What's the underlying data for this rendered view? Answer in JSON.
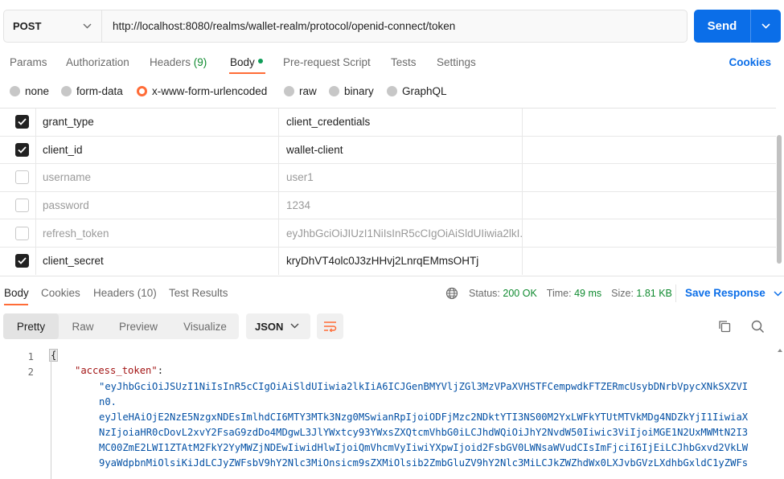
{
  "request": {
    "method": "POST",
    "url": "http://localhost:8080/realms/wallet-realm/protocol/openid-connect/token",
    "send_label": "Send"
  },
  "request_tabs": {
    "params": "Params",
    "authorization": "Authorization",
    "headers": "Headers",
    "headers_count": "(9)",
    "body": "Body",
    "pre_request": "Pre-request Script",
    "tests": "Tests",
    "settings": "Settings",
    "cookies": "Cookies"
  },
  "body_types": {
    "none": "none",
    "form_data": "form-data",
    "urlencoded": "x-www-form-urlencoded",
    "raw": "raw",
    "binary": "binary",
    "graphql": "GraphQL",
    "selected": "x-www-form-urlencoded"
  },
  "params": [
    {
      "checked": true,
      "key": "grant_type",
      "value": "client_credentials"
    },
    {
      "checked": true,
      "key": "client_id",
      "value": "wallet-client"
    },
    {
      "checked": false,
      "key": "username",
      "value": "user1"
    },
    {
      "checked": false,
      "key": "password",
      "value": "1234"
    },
    {
      "checked": false,
      "key": "refresh_token",
      "value": "eyJhbGciOiJIUzI1NiIsInR5cCIgOiAiSldUIiwia2lkI..."
    },
    {
      "checked": true,
      "key": "client_secret",
      "value": "kryDhVT4olc0J3zHHvj2LnrqEMmsOHTj"
    }
  ],
  "response_tabs": {
    "body": "Body",
    "cookies": "Cookies",
    "headers": "Headers (10)",
    "test_results": "Test Results"
  },
  "response_status": {
    "status_label": "Status:",
    "status_value": "200 OK",
    "time_label": "Time:",
    "time_value": "49 ms",
    "size_label": "Size:",
    "size_value": "1.81 KB",
    "save_response": "Save Response"
  },
  "view_tabs": {
    "pretty": "Pretty",
    "raw": "Raw",
    "preview": "Preview",
    "visualize": "Visualize",
    "format": "JSON"
  },
  "code": {
    "line1": "1",
    "line2": "2",
    "brace": "{",
    "key": "\"access_token\"",
    "colon": ":",
    "token_lines": [
      "\"eyJhbGciOiJSUzI1NiIsInR5cCIgOiAiSldUIiwia2lkIiA6ICJGenBMYVljZGl3MzVPaXVHSTFCempwdkFTZERmcUsybDNrbVpycXNkSXZVI",
      "n0.",
      "eyJleHAiOjE2NzE5NzgxNDEsImlhdCI6MTY3MTk3Nzg0MSwianRpIjoiODFjMzc2NDktYTI3NS00M2YxLWFkYTUtMTVkMDg4NDZkYjI1IiwiaX",
      "NzIjoiaHR0cDovL2xvY2FsaG9zdDo4MDgwL3JlYWxtcy93YWxsZXQtcmVhbG0iLCJhdWQiOiJhY2NvdW50Iiwic3ViIjoiMGE1N2UxMWMtN2I3",
      "MC00ZmE2LWI1ZTAtM2FkY2YyMWZjNDEwIiwidHlwIjoiQmVhcmVyIiwiYXpwIjoid2FsbGV0LWNsaWVudCIsImFjciI6IjEiLCJhbGxvd2VkLW",
      "9yaWdpbnMiOlsiKiJdLCJyZWFsbV9hY2Nlc3MiOnsicm9sZXMiOlsib2ZmbGluZV9hY2Nlc3MiLCJkZWZhdWx0LXJvbGVzLXdhbGxldC1yZWFs"
    ]
  },
  "colors": {
    "accent": "#ff6c37",
    "primary": "#0b6ee8",
    "success": "#0f8a2f"
  }
}
